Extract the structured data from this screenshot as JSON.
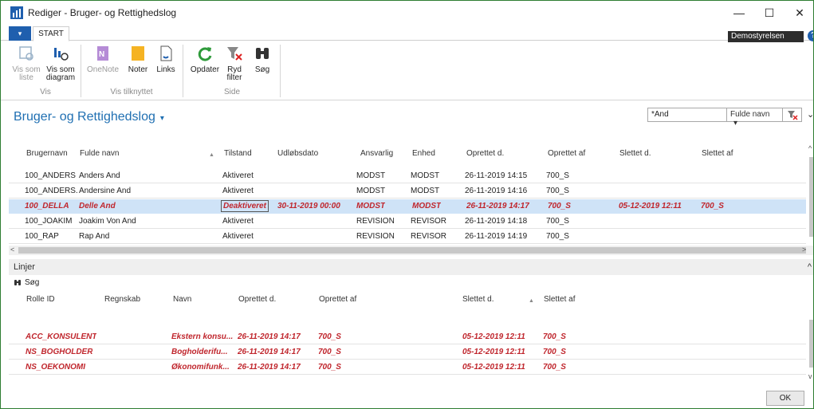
{
  "window": {
    "title": "Rediger - Bruger- og Rettighedslog",
    "minimize": "—",
    "maximize": "☐",
    "close": "✕"
  },
  "ribbon": {
    "app_menu": "▾",
    "tab": "START",
    "company": "Demostyrelsen",
    "help": "?",
    "buttons": {
      "vis_som_liste": "Vis som\nliste",
      "vis_som_diagram": "Vis som\ndiagram",
      "onenote": "OneNote",
      "noter": "Noter",
      "links": "Links",
      "opdater": "Opdater",
      "ryd_filter": "Ryd\nfilter",
      "soeg": "Søg"
    },
    "groups": {
      "vis": "Vis",
      "vis_tilknyttet": "Vis tilknyttet",
      "side": "Side"
    }
  },
  "page": {
    "title": "Bruger- og Rettighedslog",
    "chevron": "▾"
  },
  "filter": {
    "value": "*And",
    "field": "Fulde navn",
    "field_chevron": "▾",
    "collapse": "⌄"
  },
  "main_table": {
    "headers": [
      "Brugernavn",
      "Fulde navn",
      "Tilstand",
      "Udløbsdato",
      "Ansvarlig",
      "Enhed",
      "Oprettet d.",
      "Oprettet af",
      "Slettet d.",
      "Slettet af"
    ],
    "sort_marker": "▲",
    "rows": [
      [
        "100_ANDERS",
        "Anders And",
        "Aktiveret",
        "",
        "MODST",
        "MODST",
        "26-11-2019 14:15",
        "700_S",
        "",
        ""
      ],
      [
        "100_ANDERS...",
        "Andersine And",
        "Aktiveret",
        "",
        "MODST",
        "MODST",
        "26-11-2019 14:16",
        "700_S",
        "",
        ""
      ],
      [
        "100_DELLA",
        "Delle And",
        "Deaktiveret",
        "30-11-2019 00:00",
        "MODST",
        "MODST",
        "26-11-2019 14:17",
        "700_S",
        "05-12-2019 12:11",
        "700_S"
      ],
      [
        "100_JOAKIM",
        "Joakim Von And",
        "Aktiveret",
        "",
        "REVISION",
        "REVISOR",
        "26-11-2019 14:18",
        "700_S",
        "",
        ""
      ],
      [
        "100_RAP",
        "Rap And",
        "Aktiveret",
        "",
        "REVISION",
        "REVISOR",
        "26-11-2019 14:19",
        "700_S",
        "",
        ""
      ]
    ],
    "selected_row": 2
  },
  "scroll": {
    "left": "<",
    "right": ">",
    "up": "^",
    "down": "v"
  },
  "linjer": {
    "title": "Linjer",
    "collapse": "^",
    "search_label": "Søg",
    "headers": [
      "Rolle ID",
      "Regnskab",
      "Navn",
      "Oprettet d.",
      "Oprettet af",
      "Slettet d.",
      "Slettet af"
    ],
    "sort_marker": "▲",
    "rows": [
      [
        "ACC_KONSULENT",
        "",
        "Ekstern konsu...",
        "26-11-2019 14:17",
        "700_S",
        "05-12-2019 12:11",
        "700_S"
      ],
      [
        "NS_BOGHOLDER",
        "",
        "Bogholderifu...",
        "26-11-2019 14:17",
        "700_S",
        "05-12-2019 12:11",
        "700_S"
      ],
      [
        "NS_OEKONOMI",
        "",
        "Økonomifunk...",
        "26-11-2019 14:17",
        "700_S",
        "05-12-2019 12:11",
        "700_S"
      ]
    ]
  },
  "footer": {
    "ok": "OK"
  }
}
